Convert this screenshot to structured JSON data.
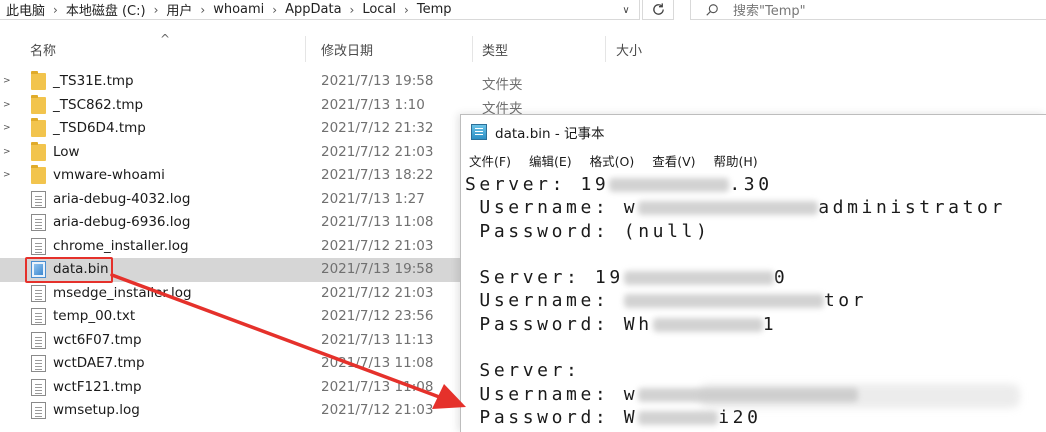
{
  "address_bar": {
    "crumbs": [
      "此电脑",
      "本地磁盘 (C:)",
      "用户",
      "whoami",
      "AppData",
      "Local",
      "Temp"
    ],
    "search_placeholder": "搜索\"Temp\""
  },
  "columns": {
    "name": "名称",
    "date": "修改日期",
    "type": "类型",
    "size": "大小"
  },
  "files": [
    {
      "name": "_TS31E.tmp",
      "date": "2021/7/13 19:58",
      "type": "文件夹",
      "kind": "folder"
    },
    {
      "name": "_TSC862.tmp",
      "date": "2021/7/13 1:10",
      "type": "文件夹",
      "kind": "folder"
    },
    {
      "name": "_TSD6D4.tmp",
      "date": "2021/7/12 21:32",
      "type": "",
      "kind": "folder"
    },
    {
      "name": "Low",
      "date": "2021/7/12 21:03",
      "type": "",
      "kind": "folder"
    },
    {
      "name": "vmware-whoami",
      "date": "2021/7/13 18:22",
      "type": "",
      "kind": "folder"
    },
    {
      "name": "aria-debug-4032.log",
      "date": "2021/7/13 1:27",
      "type": "",
      "kind": "doc"
    },
    {
      "name": "aria-debug-6936.log",
      "date": "2021/7/13 11:08",
      "type": "",
      "kind": "doc"
    },
    {
      "name": "chrome_installer.log",
      "date": "2021/7/12 21:03",
      "type": "",
      "kind": "doc"
    },
    {
      "name": "data.bin",
      "date": "2021/7/13 19:58",
      "type": "",
      "kind": "bin",
      "selected": true
    },
    {
      "name": "msedge_installer.log",
      "date": "2021/7/12 21:03",
      "type": "",
      "kind": "doc"
    },
    {
      "name": "temp_00.txt",
      "date": "2021/7/12 23:56",
      "type": "",
      "kind": "doc"
    },
    {
      "name": "wct6F07.tmp",
      "date": "2021/7/13 11:13",
      "type": "",
      "kind": "doc"
    },
    {
      "name": "wctDAE7.tmp",
      "date": "2021/7/13 11:08",
      "type": "",
      "kind": "doc"
    },
    {
      "name": "wctF121.tmp",
      "date": "2021/7/13 11:08",
      "type": "",
      "kind": "doc"
    },
    {
      "name": "wmsetup.log",
      "date": "2021/7/12 21:03",
      "type": "",
      "kind": "doc"
    }
  ],
  "notepad": {
    "title": "data.bin - 记事本",
    "menu": [
      "文件(F)",
      "编辑(E)",
      "格式(O)",
      "查看(V)",
      "帮助(H)"
    ],
    "lines": [
      {
        "text": "Server: 19",
        "redact_tail": 120,
        "suffix": ".30"
      },
      {
        "text": " Username: w",
        "redact_tail": 180,
        "suffix": "administrator"
      },
      {
        "text": " Password: (null)",
        "redact_tail": 0,
        "suffix": ""
      },
      {
        "text": "",
        "redact_tail": 0,
        "suffix": ""
      },
      {
        "text": " Server: 19",
        "redact_tail": 150,
        "suffix": "0"
      },
      {
        "text": " Username: ",
        "redact_tail": 200,
        "suffix": "tor"
      },
      {
        "text": " Password: Wh",
        "redact_tail": 110,
        "suffix": "1"
      },
      {
        "text": "",
        "redact_tail": 0,
        "suffix": ""
      },
      {
        "text": " Server: ",
        "redact_tail": 0,
        "suffix": ""
      },
      {
        "text": " Username: w",
        "redact_tail": 220,
        "suffix": ""
      },
      {
        "text": " Password: W",
        "redact_tail": 80,
        "suffix": "i20"
      }
    ]
  },
  "colors": {
    "highlight": "#e5312b",
    "arrow": "#e5312b",
    "selected_row": "#d6d6d6"
  }
}
